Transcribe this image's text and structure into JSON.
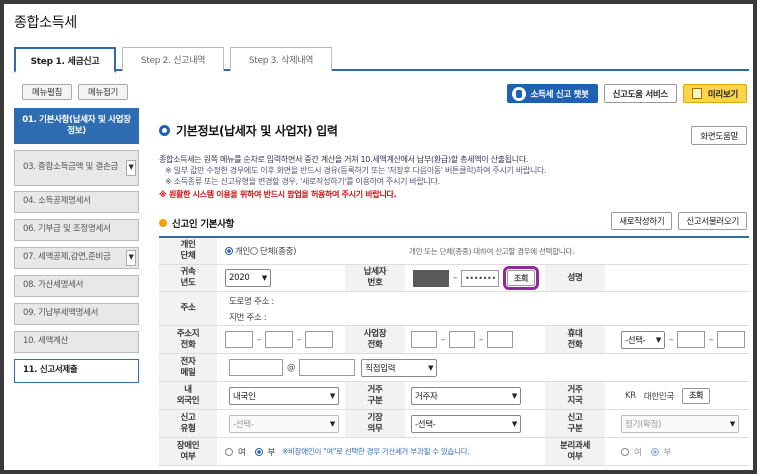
{
  "page_title": "종합소득세",
  "tabs": [
    {
      "label": "Step 1. 세금신고",
      "active": true
    },
    {
      "label": "Step 2. 신고내역",
      "active": false
    },
    {
      "label": "Step 3. 삭제내역",
      "active": false
    }
  ],
  "nav_buttons": {
    "expand": "메뉴펼침",
    "collapse": "메뉴접기"
  },
  "nav_items": [
    {
      "label": "01. 기본사항(납세자 및 사업장정보)"
    },
    {
      "label": "03. 종합소득금액 및 결손금"
    },
    {
      "label": "04. 소득공제명세서"
    },
    {
      "label": "06. 기부금 및 조정명세서"
    },
    {
      "label": "07. 세액공제,감면,준비금"
    },
    {
      "label": "08. 가산세명세서"
    },
    {
      "label": "09. 기납부세액명세서"
    },
    {
      "label": "10. 세액계산"
    },
    {
      "label": "11. 신고서제출"
    }
  ],
  "top_buttons": {
    "chatbot": "소득세 신고 챗봇",
    "help_service": "신고도움 서비스",
    "preview": "미리보기"
  },
  "section_title": "기본정보(납세자 및 사업자) 입력",
  "screen_help": "화면도움말",
  "info": {
    "line1": "종합소득세는 원쪽 메뉴를 순차로 입력하면서 중간 계산을 거쳐 10.세액계산에서 납부(환급)할 총세액이 산출됩니다.",
    "line2": "※ 일부 값만 수정한 경우에도 이후 화면을 반드시 경유(등록하기 또는 '저장후 다음이동' 버튼클릭)하여 주시기 바랍니다.",
    "line3": "※ 소득종류 또는 신고유형을 변경할 경우, '새로작성하기'를 이용하여 주시기 바랍니다.",
    "warning": "※ 원활한 시스템 이용을 위하여 반드시 팝업을 허용하여 주시기 바랍니다."
  },
  "subsection_title": "신고인 기본사항",
  "sub_buttons": {
    "new": "새로작성하기",
    "load": "신고서불러오기"
  },
  "form": {
    "type_label": "개인\n단체",
    "type_opt1": "개인",
    "type_opt2": "단체(종중)",
    "type_note": "개인 또는 단체(종중) 대하여 신고할 경우에 선택합니다.",
    "year_label": "귀속\n년도",
    "year_value": "2020",
    "taxid_label": "납세자\n번호",
    "taxid_masked": "•••••••",
    "lookup": "조회",
    "name_label": "성명",
    "addr_label": "주소",
    "addr_road": "도로명 주소 :",
    "addr_lot": "지번 주소 :",
    "home_phone_label": "주소지\n전화",
    "biz_phone_label": "사업장\n전화",
    "mobile_label": "휴대\n전화",
    "mobile_select": "-선택-",
    "email_label": "전자\n메일",
    "email_at": "@",
    "email_domain": "직접입력",
    "nationality_label": "내\n외국인",
    "nationality_value": "내국인",
    "residence_label": "거주\n구분",
    "residence_value": "거주자",
    "country_label": "거주\n지국",
    "country_code": "KR",
    "country_name": "대한민국",
    "country_lookup": "조회",
    "filing_type_label": "신고\n유형",
    "filing_type_value": "-선택-",
    "bookkeeping_label": "기장\n의무",
    "bookkeeping_value": "-선택-",
    "filing_cat_label": "신고\n구분",
    "filing_cat_value": "정기(확정)",
    "disabled_label": "장애인\n여부",
    "disabled_yes": "여",
    "disabled_no": "부",
    "disabled_note": "※비장애인이 \"여\"로 선택한 경우 가산세가 부과될 수 있습니다.",
    "separate_label": "분리과세\n여부",
    "separate_yes": "여",
    "separate_no": "부"
  }
}
